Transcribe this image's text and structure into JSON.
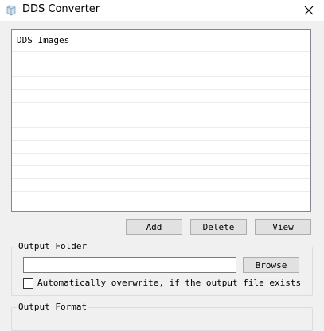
{
  "window": {
    "title": "DDS Converter",
    "icon": "app-icon",
    "close_icon": "close-icon"
  },
  "list": {
    "column_header": "DDS Images"
  },
  "buttons": {
    "add": "Add",
    "delete": "Delete",
    "view": "View",
    "browse": "Browse"
  },
  "output_folder": {
    "label": "Output Folder",
    "value": "",
    "overwrite_label": "Automatically overwrite, if the output file exists",
    "overwrite_checked": false
  },
  "output_format": {
    "label": "Output Format"
  }
}
